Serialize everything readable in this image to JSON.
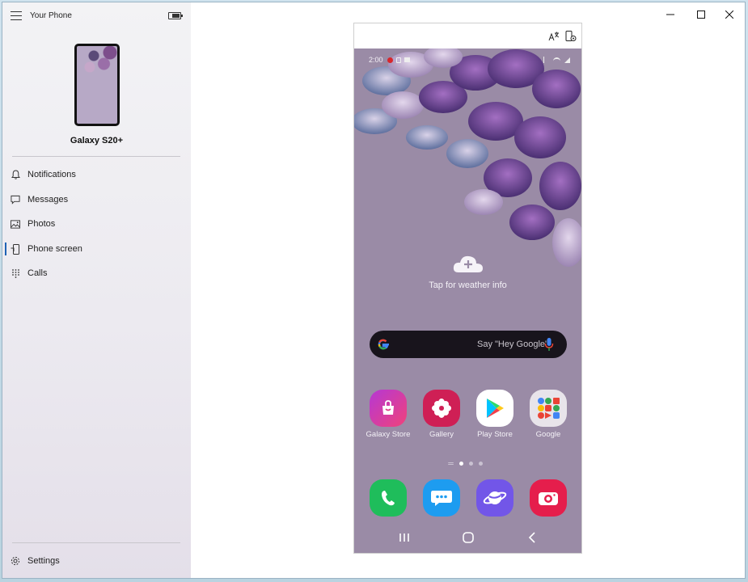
{
  "app": {
    "title": "Your Phone"
  },
  "device": {
    "name": "Galaxy S20+"
  },
  "sidebar": {
    "items": [
      {
        "label": "Notifications",
        "icon": "bell-icon"
      },
      {
        "label": "Messages",
        "icon": "message-icon"
      },
      {
        "label": "Photos",
        "icon": "photos-icon"
      },
      {
        "label": "Phone screen",
        "icon": "phone-screen-icon"
      },
      {
        "label": "Calls",
        "icon": "dialpad-icon"
      }
    ],
    "active_item": "Phone screen",
    "settings_label": "Settings"
  },
  "window_controls": {
    "icons": [
      "minimize-icon",
      "maximize-icon",
      "close-icon"
    ]
  },
  "phone_toolbar": {
    "icons": [
      "translate-icon",
      "phone-settings-icon"
    ]
  },
  "phone_screen": {
    "status_time": "2:00",
    "weather_text": "Tap for weather info",
    "search_placeholder": "Say \"Hey Google\"",
    "apps": [
      {
        "name": "Galaxy Store",
        "color": "#d63ba0"
      },
      {
        "name": "Gallery",
        "color": "#cf1f55"
      },
      {
        "name": "Play Store",
        "color": "#ffffff"
      },
      {
        "name": "Google",
        "color": "#e8e4ea"
      }
    ],
    "dock": [
      "phone-app-icon",
      "messages-app-icon",
      "internet-app-icon",
      "camera-app-icon"
    ],
    "pager": {
      "pages": 3,
      "current": 1
    },
    "nav_icons": [
      "recents-icon",
      "home-icon",
      "back-icon"
    ]
  },
  "colors": {
    "accent": "#1f63b5",
    "sidebar_bg": "#eceaf0",
    "wallpaper": "#9a8ba6"
  }
}
